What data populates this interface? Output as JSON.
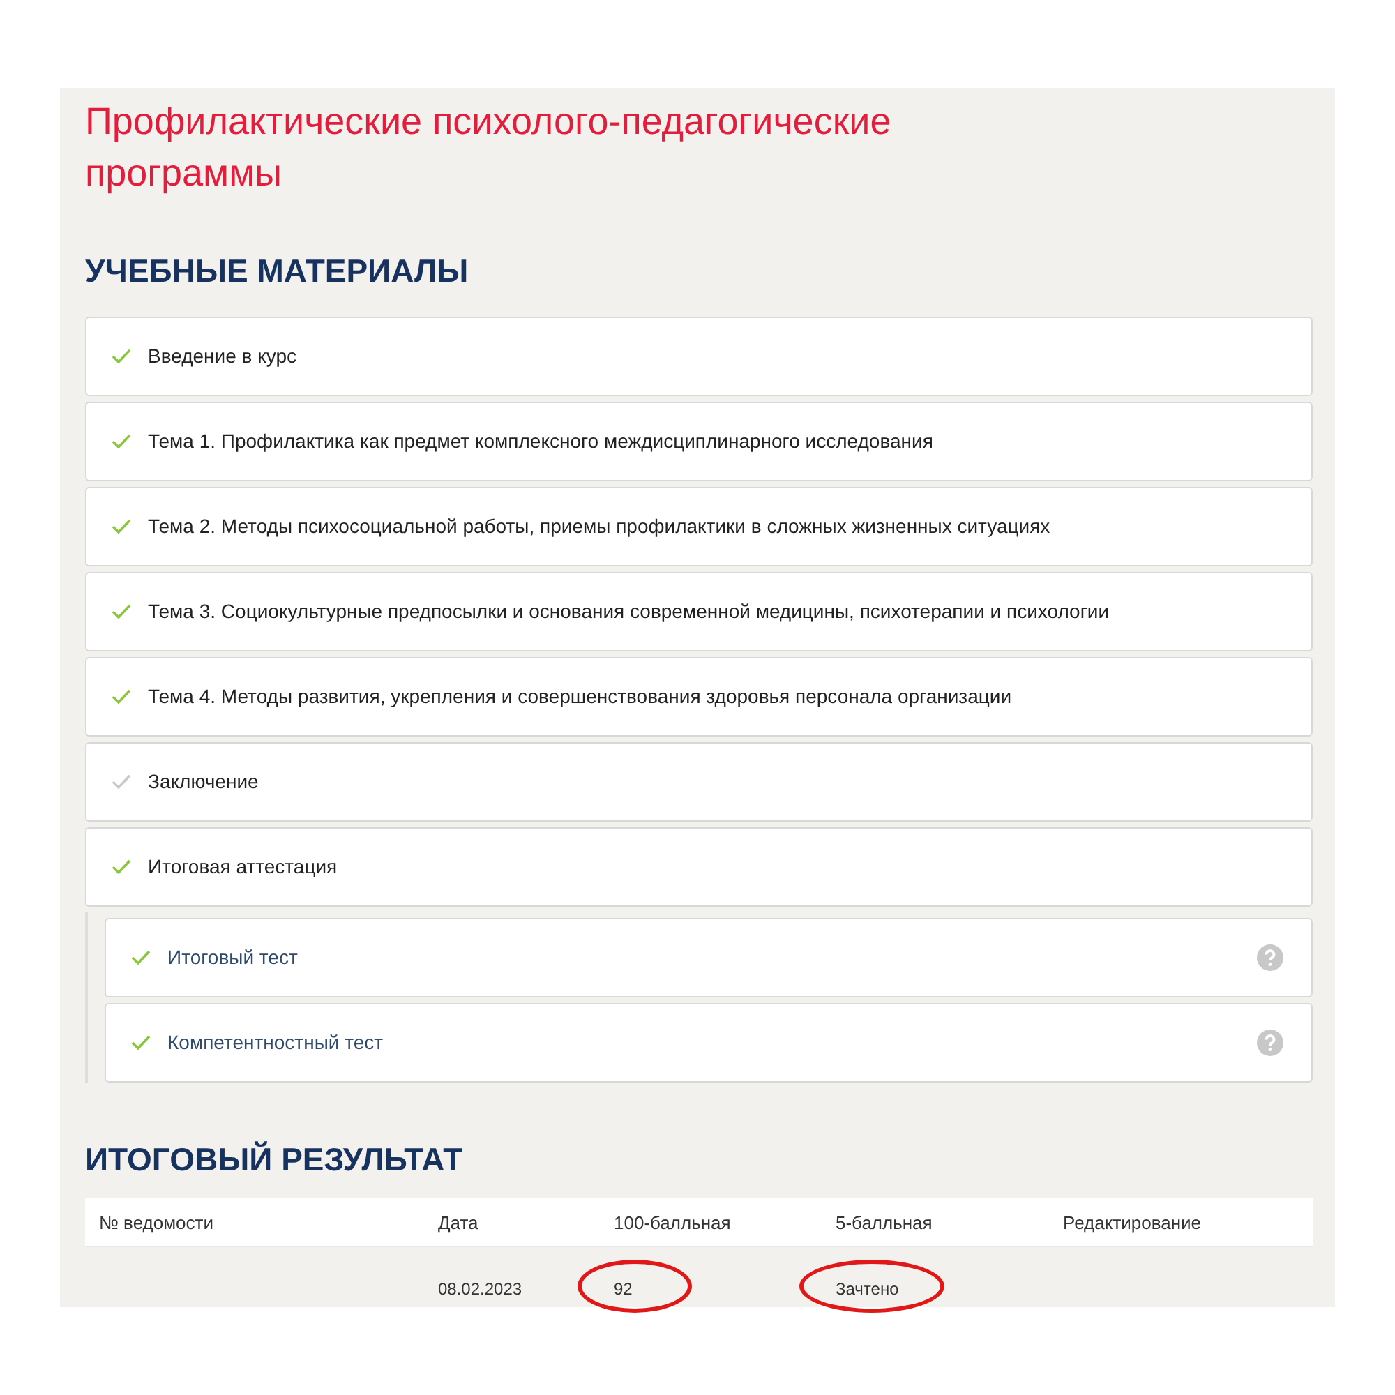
{
  "course_title": "Профилактические психолого-педагогические программы",
  "materials": {
    "heading": "УЧЕБНЫЕ МАТЕРИАЛЫ",
    "items": [
      {
        "label": "Введение в курс",
        "completed": true
      },
      {
        "label": "Тема 1. Профилактика как предмет комплексного междисциплинарного исследования",
        "completed": true
      },
      {
        "label": "Тема 2. Методы психосоциальной работы, приемы профилактики в сложных жизненных ситуациях",
        "completed": true
      },
      {
        "label": "Тема 3. Социокультурные предпосылки и основания современной медицины, психотерапии и психологии",
        "completed": true
      },
      {
        "label": "Тема 4. Методы развития, укрепления и совершенствования здоровья персонала организации",
        "completed": true
      },
      {
        "label": "Заключение",
        "completed": false
      },
      {
        "label": "Итоговая аттестация",
        "completed": true,
        "children": [
          {
            "label": "Итоговый тест",
            "completed": true
          },
          {
            "label": "Компетентностный тест",
            "completed": true
          }
        ]
      }
    ]
  },
  "result": {
    "heading": "ИТОГОВЫЙ РЕЗУЛЬТАТ",
    "columns": [
      "№ ведомости",
      "Дата",
      "100-балльная",
      "5-балльная",
      "Редактирование"
    ],
    "rows": [
      {
        "cells": [
          {
            "text": ""
          },
          {
            "text": "08.02.2023",
            "circled": false
          },
          {
            "text": "92",
            "circled": true
          },
          {
            "text": "Зачтено",
            "circled": true
          },
          {
            "text": ""
          }
        ]
      }
    ]
  }
}
